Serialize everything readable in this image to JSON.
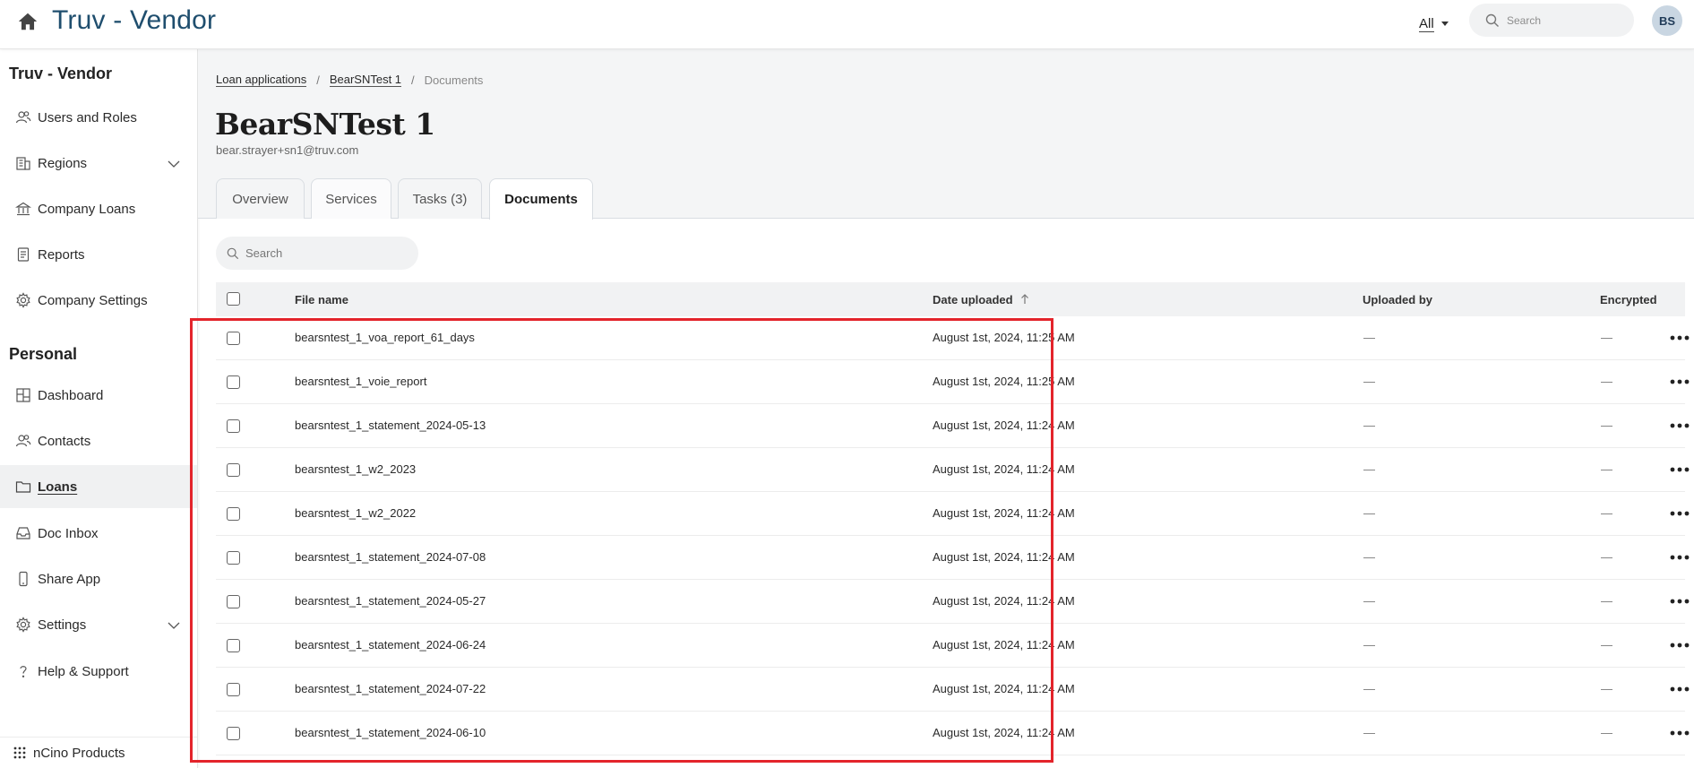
{
  "app": {
    "title": "Truv - Vendor"
  },
  "topbar": {
    "scope_label": "All",
    "search_placeholder": "Search",
    "avatar_initials": "BS"
  },
  "sidebar": {
    "org_heading": "Truv - Vendor",
    "org_items": [
      {
        "label": "Users and Roles",
        "icon": "users-icon"
      },
      {
        "label": "Regions",
        "icon": "building-icon",
        "expandable": true
      },
      {
        "label": "Company Loans",
        "icon": "bank-icon"
      },
      {
        "label": "Reports",
        "icon": "report-icon"
      },
      {
        "label": "Company Settings",
        "icon": "gear-icon"
      }
    ],
    "personal_heading": "Personal",
    "personal_items": [
      {
        "label": "Dashboard",
        "icon": "dashboard-icon"
      },
      {
        "label": "Contacts",
        "icon": "contacts-icon"
      },
      {
        "label": "Loans",
        "icon": "folder-icon",
        "active": true
      },
      {
        "label": "Doc Inbox",
        "icon": "inbox-icon"
      },
      {
        "label": "Share App",
        "icon": "phone-icon"
      },
      {
        "label": "Settings",
        "icon": "gear-icon",
        "expandable": true
      },
      {
        "label": "Help & Support",
        "icon": "question-icon"
      }
    ],
    "footer_label": "nCino Products"
  },
  "breadcrumb": {
    "items": [
      "Loan applications",
      "BearSNTest 1"
    ],
    "current": "Documents"
  },
  "page": {
    "title": "BearSNTest 1",
    "subtitle": "bear.strayer+sn1@truv.com"
  },
  "tabs": [
    {
      "label": "Overview",
      "active": false
    },
    {
      "label": "Services",
      "active": false
    },
    {
      "label": "Tasks (3)",
      "active": false
    },
    {
      "label": "Documents",
      "active": true
    }
  ],
  "documents": {
    "search_placeholder": "Search",
    "columns": {
      "file_name": "File name",
      "date_uploaded": "Date uploaded",
      "uploaded_by": "Uploaded by",
      "encrypted": "Encrypted"
    },
    "sort": {
      "column": "date_uploaded",
      "direction": "ascending"
    },
    "rows": [
      {
        "file_name": "bearsntest_1_voa_report_61_days",
        "date_uploaded": "August 1st, 2024, 11:25 AM",
        "uploaded_by": "—",
        "encrypted": "—"
      },
      {
        "file_name": "bearsntest_1_voie_report",
        "date_uploaded": "August 1st, 2024, 11:25 AM",
        "uploaded_by": "—",
        "encrypted": "—"
      },
      {
        "file_name": "bearsntest_1_statement_2024-05-13",
        "date_uploaded": "August 1st, 2024, 11:24 AM",
        "uploaded_by": "—",
        "encrypted": "—"
      },
      {
        "file_name": "bearsntest_1_w2_2023",
        "date_uploaded": "August 1st, 2024, 11:24 AM",
        "uploaded_by": "—",
        "encrypted": "—"
      },
      {
        "file_name": "bearsntest_1_w2_2022",
        "date_uploaded": "August 1st, 2024, 11:24 AM",
        "uploaded_by": "—",
        "encrypted": "—"
      },
      {
        "file_name": "bearsntest_1_statement_2024-07-08",
        "date_uploaded": "August 1st, 2024, 11:24 AM",
        "uploaded_by": "—",
        "encrypted": "—"
      },
      {
        "file_name": "bearsntest_1_statement_2024-05-27",
        "date_uploaded": "August 1st, 2024, 11:24 AM",
        "uploaded_by": "—",
        "encrypted": "—"
      },
      {
        "file_name": "bearsntest_1_statement_2024-06-24",
        "date_uploaded": "August 1st, 2024, 11:24 AM",
        "uploaded_by": "—",
        "encrypted": "—"
      },
      {
        "file_name": "bearsntest_1_statement_2024-07-22",
        "date_uploaded": "August 1st, 2024, 11:24 AM",
        "uploaded_by": "—",
        "encrypted": "—"
      },
      {
        "file_name": "bearsntest_1_statement_2024-06-10",
        "date_uploaded": "August 1st, 2024, 11:24 AM",
        "uploaded_by": "—",
        "encrypted": "—"
      }
    ]
  },
  "colors": {
    "brand": "#1f4e6e",
    "highlight": "#e3242b",
    "header_bg": "#f4f5f6"
  }
}
